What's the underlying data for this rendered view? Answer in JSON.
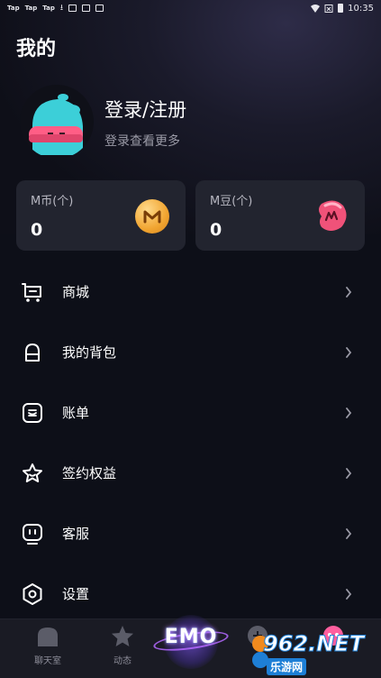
{
  "status_bar": {
    "left_items": [
      "Tap",
      "Tap",
      "Tap"
    ],
    "time": "10:35"
  },
  "page_title": "我的",
  "profile": {
    "login_title": "登录/注册",
    "login_subtitle": "登录查看更多"
  },
  "wallet": {
    "coins": {
      "label": "M币(个)",
      "value": "0",
      "icon": "m-coin-icon"
    },
    "beans": {
      "label": "M豆(个)",
      "value": "0",
      "icon": "m-bean-icon"
    }
  },
  "menu": [
    {
      "label": "商城",
      "icon": "cart-icon"
    },
    {
      "label": "我的背包",
      "icon": "backpack-icon"
    },
    {
      "label": "账单",
      "icon": "bill-icon"
    },
    {
      "label": "签约权益",
      "icon": "star-badge-icon"
    },
    {
      "label": "客服",
      "icon": "service-icon"
    },
    {
      "label": "设置",
      "icon": "settings-icon"
    }
  ],
  "bottom_nav": {
    "items": [
      {
        "label": "聊天室",
        "icon": "home-icon"
      },
      {
        "label": "动态",
        "icon": "star-icon"
      },
      {
        "label": "",
        "icon": "game-icon"
      },
      {
        "label": "",
        "icon": "profile-icon"
      }
    ],
    "center_logo": "EMO"
  },
  "watermark": {
    "brand": "962.NET",
    "site": "乐游网"
  },
  "colors": {
    "background": "#0d0f18",
    "card": "#22242f",
    "muted_text": "#9a9aa6",
    "coin_gold": "#f1a531",
    "bean_pink": "#e84a74",
    "avatar_teal": "#35c9d2"
  }
}
